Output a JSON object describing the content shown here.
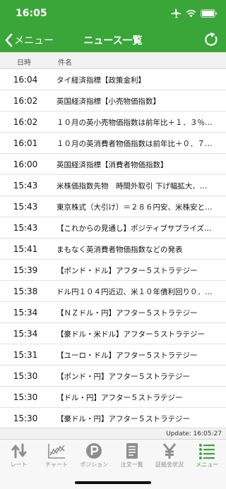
{
  "status": {
    "time": "16:05"
  },
  "nav": {
    "back_label": "メニュー",
    "title": "ニュース一覧"
  },
  "header": {
    "time_col": "日時",
    "title_col": "件名"
  },
  "news": [
    {
      "time": "16:04",
      "subject": "タイ経済指標【政策金利】"
    },
    {
      "time": "16:02",
      "subject": "英国経済指標【小売物価指数】"
    },
    {
      "time": "16:02",
      "subject": "１０月の英小売物価指数は前年比＋１．３％…"
    },
    {
      "time": "16:01",
      "subject": "１０月の英消費者物価指数は前年比＋０．７…"
    },
    {
      "time": "16:00",
      "subject": "英国経済指標【消費者物価指数】"
    },
    {
      "time": "15:43",
      "subject": "米株価指数先物　時間外取引 下げ幅拡大、…"
    },
    {
      "time": "15:43",
      "subject": "東京株式（大引け）＝２８６円安、米株安と…"
    },
    {
      "time": "15:43",
      "subject": "【これからの見通し】ポジティブサプライズ…"
    },
    {
      "time": "15:41",
      "subject": "まもなく英消費者物価指数などの発表"
    },
    {
      "time": "15:39",
      "subject": "【ポンド・ドル】アフター５ストラテジー"
    },
    {
      "time": "15:38",
      "subject": "ドル円１０４円近辺、米１０年債利回り０．…"
    },
    {
      "time": "15:34",
      "subject": "【ＮＺドル・円】アフター５ストラテジー"
    },
    {
      "time": "15:34",
      "subject": "【豪ドル・米ドル】アフター５ストラテジー"
    },
    {
      "time": "15:31",
      "subject": "【ユーロ・ドル】アフター５ストラテジー"
    },
    {
      "time": "15:30",
      "subject": "【ポンド・円】アフター５ストラテジー"
    },
    {
      "time": "15:30",
      "subject": "【ドル・円】アフター５ストラテジー"
    },
    {
      "time": "15:30",
      "subject": "【豪ドル・円】アフター５ストラテジー"
    }
  ],
  "update": {
    "text": "Update: 16:05:27"
  },
  "tabs": [
    {
      "label": "レート",
      "icon": "rate-arrows-icon"
    },
    {
      "label": "チャート",
      "icon": "chart-icon"
    },
    {
      "label": "ポジション",
      "icon": "position-icon"
    },
    {
      "label": "注文一覧",
      "icon": "order-list-icon"
    },
    {
      "label": "証拠金状況",
      "icon": "yen-icon"
    },
    {
      "label": "メニュー",
      "icon": "menu-list-icon"
    }
  ],
  "colors": {
    "brand": "#3aa63a",
    "tab_inactive": "#8e8e8e"
  }
}
